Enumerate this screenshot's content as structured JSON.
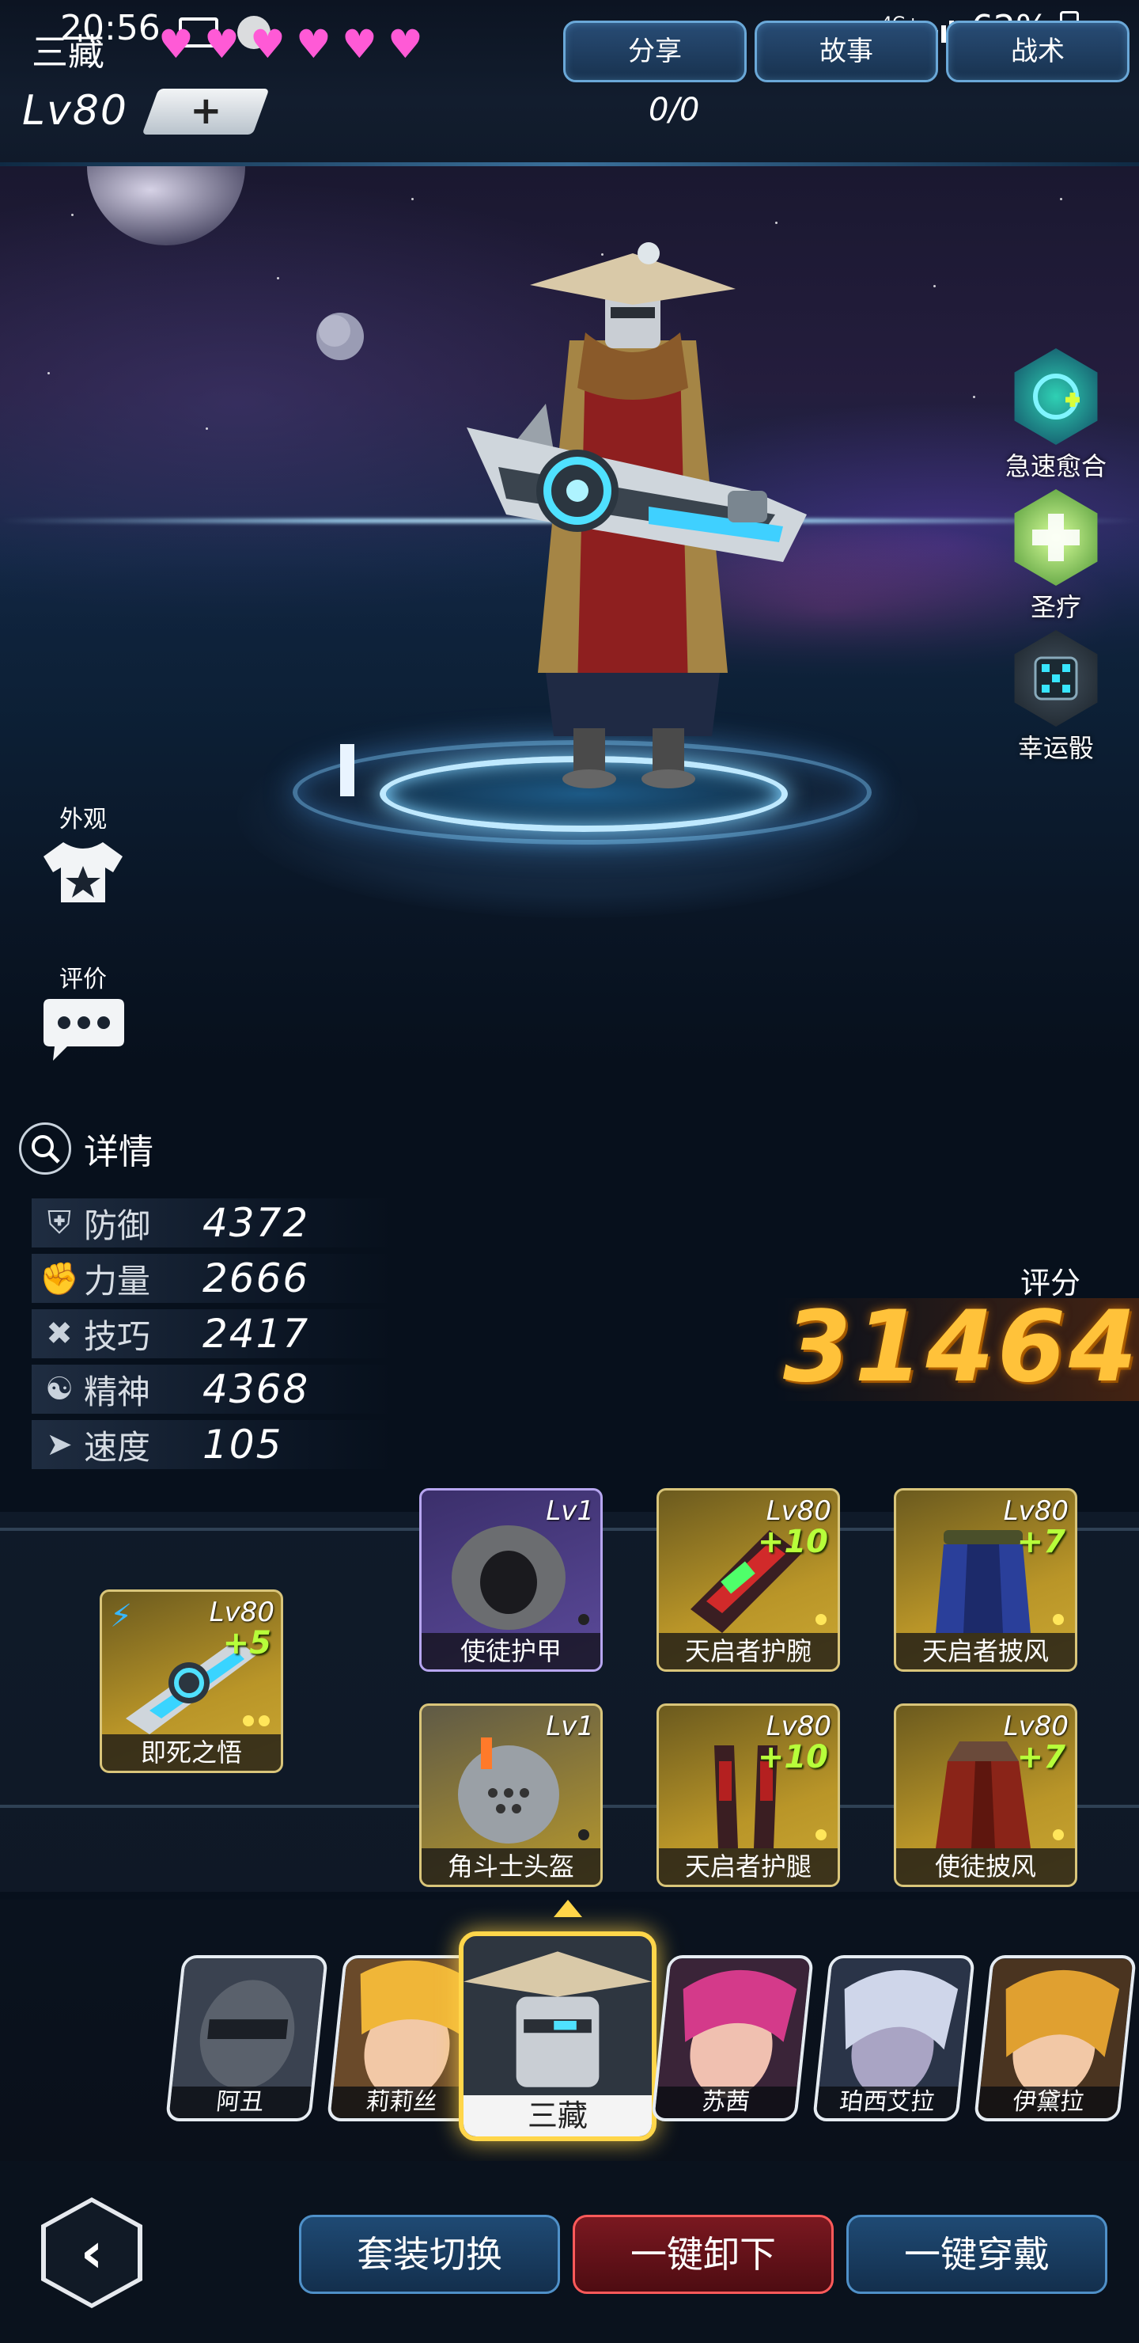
{
  "status_bar": {
    "time": "20:56",
    "network": "4G+",
    "battery": "62%"
  },
  "header": {
    "hero_name": "三藏",
    "hearts": 6,
    "buttons": {
      "share": "分享",
      "story": "故事",
      "tactics": "战术"
    },
    "level": "Lv80",
    "level_plus": "+",
    "exp": "0/0"
  },
  "skills": [
    {
      "label": "急速愈合",
      "icon": "healing-rune-icon"
    },
    {
      "label": "圣疗",
      "icon": "holy-heal-icon"
    },
    {
      "label": "幸运骰",
      "icon": "lucky-dice-icon"
    }
  ],
  "side_buttons": {
    "appearance": "外观",
    "review": "评价"
  },
  "details": {
    "title": "详情",
    "stats": [
      {
        "label": "防御",
        "value": "4372",
        "icon": "shield-icon"
      },
      {
        "label": "力量",
        "value": "2666",
        "icon": "fist-icon"
      },
      {
        "label": "技巧",
        "value": "2417",
        "icon": "cross-tools-icon"
      },
      {
        "label": "精神",
        "value": "4368",
        "icon": "mind-icon"
      },
      {
        "label": "速度",
        "value": "105",
        "icon": "speed-icon"
      }
    ]
  },
  "score": {
    "label": "评分",
    "value": "31464"
  },
  "equipment": {
    "weapon": {
      "name": "即死之悟",
      "level": "Lv80",
      "plus": "+5"
    },
    "slots": [
      {
        "name": "使徒护甲",
        "level": "Lv1",
        "plus": ""
      },
      {
        "name": "天启者护腕",
        "level": "Lv80",
        "plus": "+10"
      },
      {
        "name": "天启者披风",
        "level": "Lv80",
        "plus": "+7"
      },
      {
        "name": "角斗士头盔",
        "level": "Lv1",
        "plus": ""
      },
      {
        "name": "天启者护腿",
        "level": "Lv80",
        "plus": "+10"
      },
      {
        "name": "使徒披风",
        "level": "Lv80",
        "plus": "+7"
      }
    ]
  },
  "roster": [
    {
      "name": "阿丑"
    },
    {
      "name": "莉莉丝"
    },
    {
      "name": "三藏"
    },
    {
      "name": "苏茜"
    },
    {
      "name": "珀西艾拉"
    },
    {
      "name": "伊黛拉"
    }
  ],
  "bottom_buttons": {
    "switch_set": "套装切换",
    "unequip_all": "一键卸下",
    "equip_all": "一键穿戴"
  },
  "colors": {
    "accent_gold": "#ffc23a",
    "heart_pink": "#ff5ad6",
    "plus_green": "#b7ff3a"
  }
}
